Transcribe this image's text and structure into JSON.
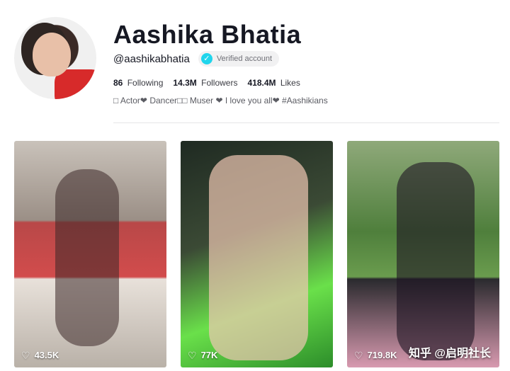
{
  "profile": {
    "name": "Aashika Bhatia",
    "handle": "@aashikabhatia",
    "verified_label": "Verified account",
    "stats": {
      "following_count": "86",
      "following_label": "Following",
      "followers_count": "14.3M",
      "followers_label": "Followers",
      "likes_count": "418.4M",
      "likes_label": "Likes"
    },
    "bio": "□ Actor❤ Dancer□□ Muser ❤ I love you all❤ #Aashikians"
  },
  "videos": [
    {
      "likes": "43.5K",
      "icon": "heart-outline-icon"
    },
    {
      "likes": "77K",
      "icon": "heart-outline-icon"
    },
    {
      "likes": "719.8K",
      "icon": "heart-outline-icon"
    }
  ],
  "watermark": "知乎 @启明社长",
  "colors": {
    "verified_badge": "#20d5ec",
    "text_primary": "#161823",
    "divider": "#e5e5e7"
  }
}
